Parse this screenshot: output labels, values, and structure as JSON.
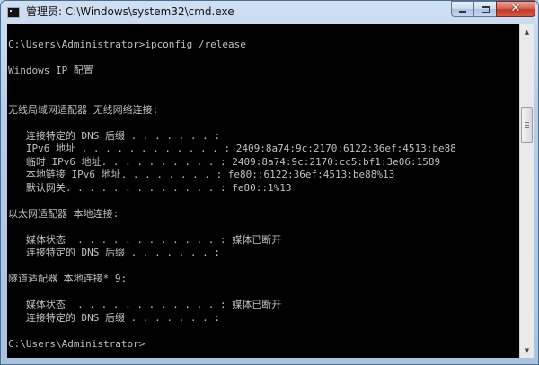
{
  "window": {
    "title": "管理员: C:\\Windows\\system32\\cmd.exe",
    "icon": "cmd-icon",
    "controls": {
      "minimize": "minimize-icon",
      "maximize": "maximize-icon",
      "close": "close-icon",
      "close_glyph": "✕"
    }
  },
  "colors": {
    "console_bg": "#000000",
    "console_text": "#c0c0c0",
    "close_button": "#c0392b"
  },
  "console": {
    "lines": [
      "C:\\Users\\Administrator>ipconfig /release",
      "",
      "Windows IP 配置",
      "",
      "",
      "无线局域网适配器 无线网络连接:",
      "",
      "   连接特定的 DNS 后缀 . . . . . . . :",
      "   IPv6 地址 . . . . . . . . . . . . : 2409:8a74:9c:2170:6122:36ef:4513:be88",
      "   临时 IPv6 地址. . . . . . . . . . : 2409:8a74:9c:2170:cc5:bf1:3e06:1589",
      "   本地链接 IPv6 地址. . . . . . . . : fe80::6122:36ef:4513:be88%13",
      "   默认网关. . . . . . . . . . . . . : fe80::1%13",
      "",
      "以太网适配器 本地连接:",
      "",
      "   媒体状态  . . . . . . . . . . . . : 媒体已断开",
      "   连接特定的 DNS 后缀 . . . . . . . :",
      "",
      "隧道适配器 本地连接* 9:",
      "",
      "   媒体状态  . . . . . . . . . . . . : 媒体已断开",
      "   连接特定的 DNS 后缀 . . . . . . . :",
      "",
      "C:\\Users\\Administrator>"
    ]
  },
  "scrollbar": {
    "up_arrow": "▲",
    "down_arrow": "▼",
    "position": 0.25
  }
}
